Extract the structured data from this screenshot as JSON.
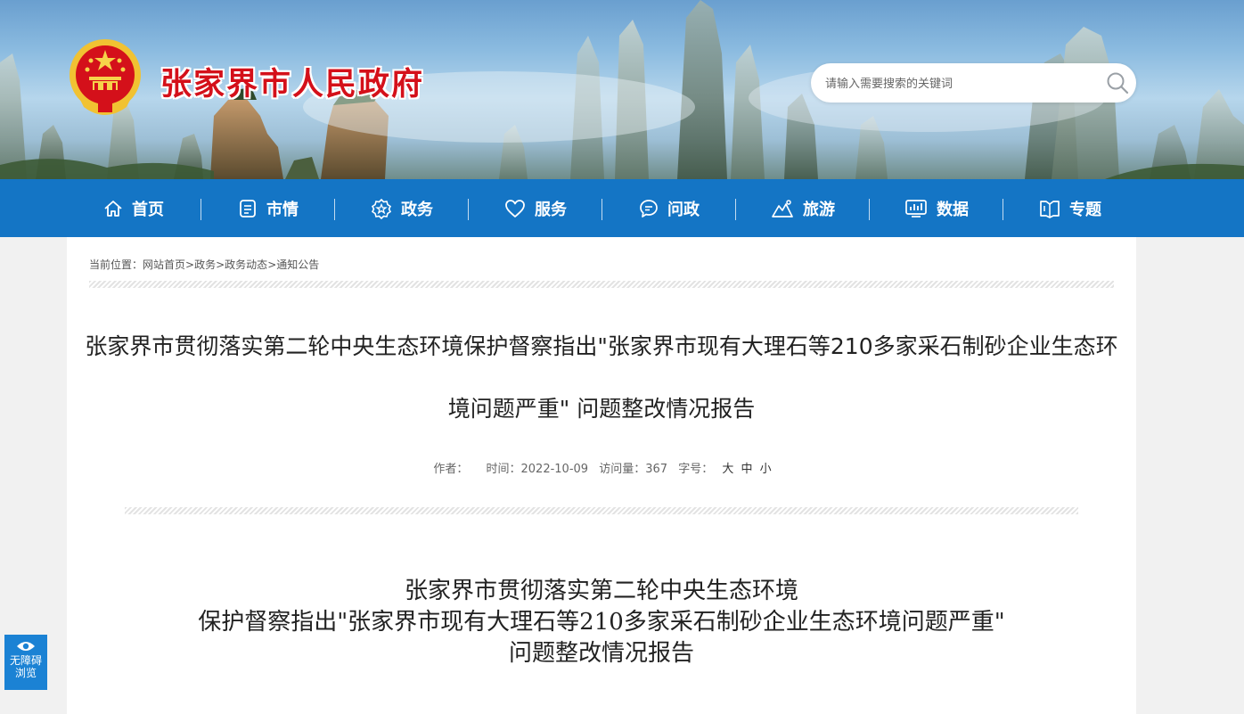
{
  "site": {
    "title": "张家界市人民政府",
    "emblem_icon": "national-emblem-icon"
  },
  "search": {
    "placeholder": "请输入需要搜索的关键词",
    "value": "",
    "icon": "search-icon"
  },
  "nav": {
    "items": [
      {
        "label": "首页",
        "icon": "home-icon"
      },
      {
        "label": "市情",
        "icon": "document-icon"
      },
      {
        "label": "政务",
        "icon": "star-badge-icon"
      },
      {
        "label": "服务",
        "icon": "heart-icon"
      },
      {
        "label": "问政",
        "icon": "chat-bubble-icon"
      },
      {
        "label": "旅游",
        "icon": "mountain-icon"
      },
      {
        "label": "数据",
        "icon": "chart-screen-icon"
      },
      {
        "label": "专题",
        "icon": "book-icon"
      }
    ]
  },
  "breadcrumb": {
    "prefix": "当前位置：",
    "items": [
      "网站首页",
      "政务",
      "政务动态",
      "通知公告"
    ],
    "separator": ">"
  },
  "article": {
    "title": "张家界市贯彻落实第二轮中央生态环境保护督察指出\"张家界市现有大理石等210多家采石制砂企业生态环境问题严重\" 问题整改情况报告",
    "meta": {
      "author_label": "作者：",
      "author": "",
      "time_label": "时间：",
      "time": "2022-10-09",
      "views_label": "访问量：",
      "views": "367",
      "fontsize_label": "字号：",
      "fontsize_options": [
        "大",
        "中",
        "小"
      ]
    },
    "body_title_lines": [
      "张家界市贯彻落实第二轮中央生态环境",
      "保护督察指出\"张家界市现有大理石等210多家采石制砂企业生态环境问题严重\"",
      "问题整改情况报告"
    ]
  },
  "accessibility": {
    "line1": "无障碍",
    "line2": "浏览",
    "icon": "eye-icon"
  },
  "colors": {
    "nav_bg": "#1475c5",
    "title_red": "#d4101a",
    "a11y_bg": "#1b82d4"
  }
}
